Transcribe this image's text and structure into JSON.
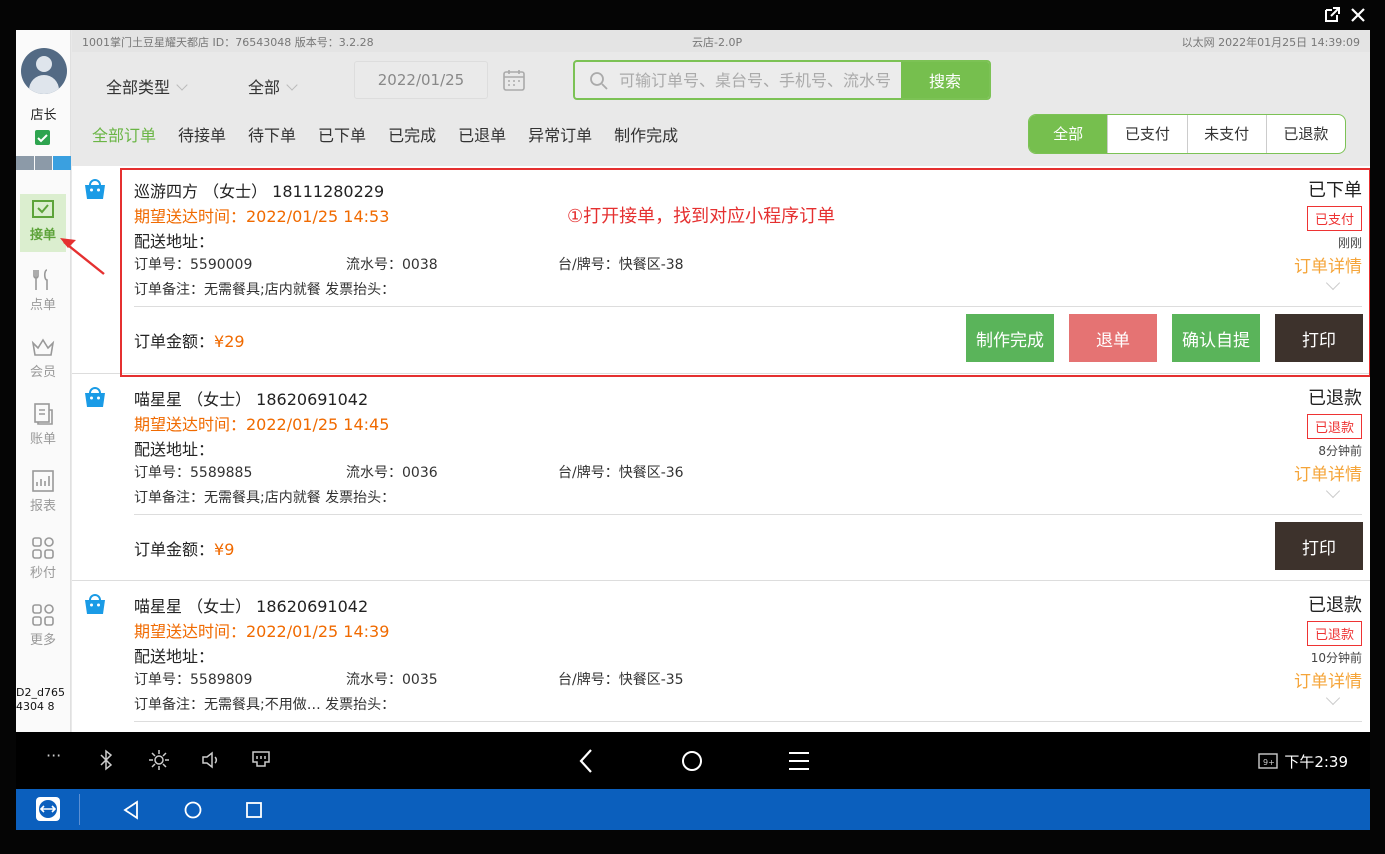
{
  "window": {
    "icons": [
      "popout-icon",
      "close-icon"
    ]
  },
  "sidebar": {
    "role": "店长",
    "device_id": "D2_d7654304 8",
    "items": [
      {
        "label": "接单",
        "icon": "inbox-icon",
        "active": true
      },
      {
        "label": "点单",
        "icon": "cutlery-icon"
      },
      {
        "label": "会员",
        "icon": "crown-icon"
      },
      {
        "label": "账单",
        "icon": "bill-icon"
      },
      {
        "label": "报表",
        "icon": "chart-icon"
      },
      {
        "label": "秒付",
        "icon": "grid-icon"
      },
      {
        "label": "更多",
        "icon": "more-grid-icon"
      }
    ]
  },
  "infobar": {
    "store": "1001掌门土豆星耀天都店 ID：76543048   版本号：3.2.28",
    "center": "云店-2.0P",
    "right": "以太网   2022年01月25日 14:39:09"
  },
  "toolbar": {
    "type_filter": "全部类型",
    "status_filter": "全部",
    "date": "2022/01/25",
    "search_placeholder": "可输订单号、桌台号、手机号、流水号",
    "search_button": "搜索"
  },
  "tabs": [
    "全部订单",
    "待接单",
    "待下单",
    "已下单",
    "已完成",
    "已退单",
    "异常订单",
    "制作完成"
  ],
  "pay_filter": [
    "全部",
    "已支付",
    "未支付",
    "已退款"
  ],
  "annotation": "①打开接单，找到对应小程序订单",
  "orders": [
    {
      "name": "巡游四方 （女士） 18111280229",
      "time": "期望送达时间：2022/01/25  14:53",
      "addr": "配送地址：",
      "order_no": "订单号：5590009",
      "serial": "流水号：0038",
      "table": "台/牌号：快餐区-38",
      "remark": "订单备注：无需餐具;店内就餐 发票抬头：",
      "status": "已下单",
      "badge": "已支付",
      "ago": "刚刚",
      "detail": "订单详情",
      "amount_label": "订单金额：",
      "amount": "¥29",
      "buttons": {
        "done": "制作完成",
        "refund": "退单",
        "pickup": "确认自提",
        "print": "打印"
      }
    },
    {
      "name": "喵星星 （女士） 18620691042",
      "time": "期望送达时间：2022/01/25  14:45",
      "addr": "配送地址：",
      "order_no": "订单号：5589885",
      "serial": "流水号：0036",
      "table": "台/牌号：快餐区-36",
      "remark": "订单备注：无需餐具;店内就餐 发票抬头：",
      "status": "已退款",
      "badge": "已退款",
      "ago": "8分钟前",
      "detail": "订单详情",
      "amount_label": "订单金额：",
      "amount": "¥9",
      "buttons": {
        "print": "打印"
      }
    },
    {
      "name": "喵星星 （女士） 18620691042",
      "time": "期望送达时间：2022/01/25  14:39",
      "addr": "配送地址：",
      "order_no": "订单号：5589809",
      "serial": "流水号：0035",
      "table": "台/牌号：快餐区-35",
      "remark": "订单备注：无需餐具;不用做… 发票抬头：",
      "status": "已退款",
      "badge": "已退款",
      "ago": "10分钟前",
      "detail": "订单详情"
    }
  ],
  "android_nav": {
    "clock": "下午2:39",
    "dots": "···"
  },
  "colors": {
    "accent": "#76bf4e",
    "orange": "#f06a00",
    "red": "#e53030",
    "taskbar": "#0b5fbd"
  }
}
